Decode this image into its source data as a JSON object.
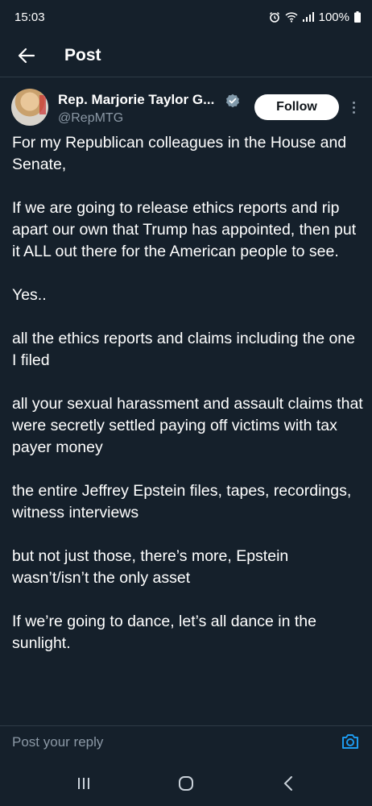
{
  "status_bar": {
    "time": "15:03",
    "battery": "100%",
    "icons": [
      "alarm-icon",
      "wifi-icon",
      "signal-icon",
      "battery-icon"
    ]
  },
  "header": {
    "title": "Post",
    "back_icon": "arrow-left-icon"
  },
  "author": {
    "name": "Rep. Marjorie Taylor G...",
    "handle": "@RepMTG",
    "verified_icon": "verified-badge-icon",
    "follow_label": "Follow"
  },
  "post": {
    "paragraphs": [
      "For my Republican colleagues in the House and Senate,",
      "If we are going to release ethics reports and rip apart our own that Trump has appointed, then put it ALL out there for the American people to see.",
      "Yes..",
      "all the ethics reports and claims including the one I filed",
      "all your sexual harassment and assault claims that were secretly settled paying off victims with tax payer money",
      "the entire Jeffrey Epstein files, tapes, recordings, witness interviews",
      "but not just those, there’s more, Epstein wasn’t/isn’t the only asset",
      "If we’re going to dance, let’s all dance in the sunlight."
    ]
  },
  "reply": {
    "placeholder": "Post your reply",
    "camera_icon": "camera-icon"
  },
  "nav": {
    "items": [
      "recents-icon",
      "home-icon",
      "back-icon"
    ]
  },
  "colors": {
    "background": "#15202b",
    "text": "#ffffff",
    "muted": "#8b98a5",
    "accent": "#1d9bf0"
  }
}
